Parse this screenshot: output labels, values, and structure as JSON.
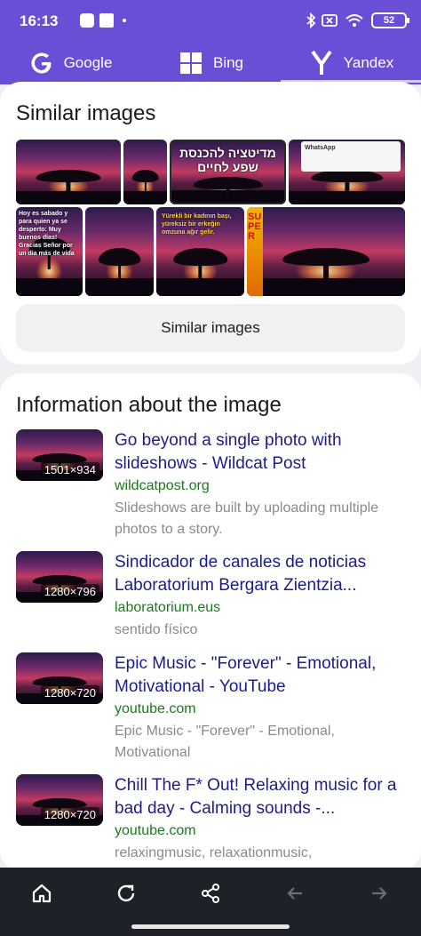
{
  "status_bar": {
    "time": "16:13",
    "battery": "52"
  },
  "tabs": [
    {
      "label": "Google",
      "icon": "google-icon"
    },
    {
      "label": "Bing",
      "icon": "bing-icon"
    },
    {
      "label": "Yandex",
      "icon": "yandex-icon",
      "active": true
    }
  ],
  "similar": {
    "title": "Similar images",
    "button_label": "Similar images",
    "thumbs": [
      {
        "overlay": ""
      },
      {
        "overlay": ""
      },
      {
        "overlay": "מדיטציה להכנסת שפע לחיים"
      },
      {
        "overlay": "WhatsApp"
      },
      {
        "overlay": ""
      },
      {
        "overlay": "Hoy es sabado y para quien ya se desperto: Muy buenos dias! Gracias Señor por un dia más de vida"
      },
      {
        "overlay": ""
      },
      {
        "overlay": "Yürekli bir kadının başı, yüreksiz bir erkeğin omzuna ağır gelir."
      },
      {
        "overlay": "SUPER"
      }
    ]
  },
  "info": {
    "title": "Information about the image",
    "results": [
      {
        "size": "1501×934",
        "title": "Go beyond a single photo with slideshows - Wildcat Post",
        "domain": "wildcatpost.org",
        "desc": "Slideshows are built by uploading multiple photos to a story."
      },
      {
        "size": "1280×796",
        "title": "Sindicador de canales de noticias Laboratorium Bergara Zientzia...",
        "domain": "laboratorium.eus",
        "desc": "sentido físico"
      },
      {
        "size": "1280×720",
        "title": "Epic Music - \"Forever\" - Emotional, Motivational - YouTube",
        "domain": "youtube.com",
        "desc": "Epic Music - \"Forever\" - Emotional, Motivational"
      },
      {
        "size": "1280×720",
        "title": "Chill The F* Out! Relaxing music for a bad day - Calming sounds -...",
        "domain": "youtube.com",
        "desc": "relaxingmusic, relaxationmusic,"
      }
    ]
  },
  "bottom_nav": [
    "home-icon",
    "refresh-icon",
    "share-icon",
    "back-arrow-icon",
    "forward-arrow-icon"
  ]
}
